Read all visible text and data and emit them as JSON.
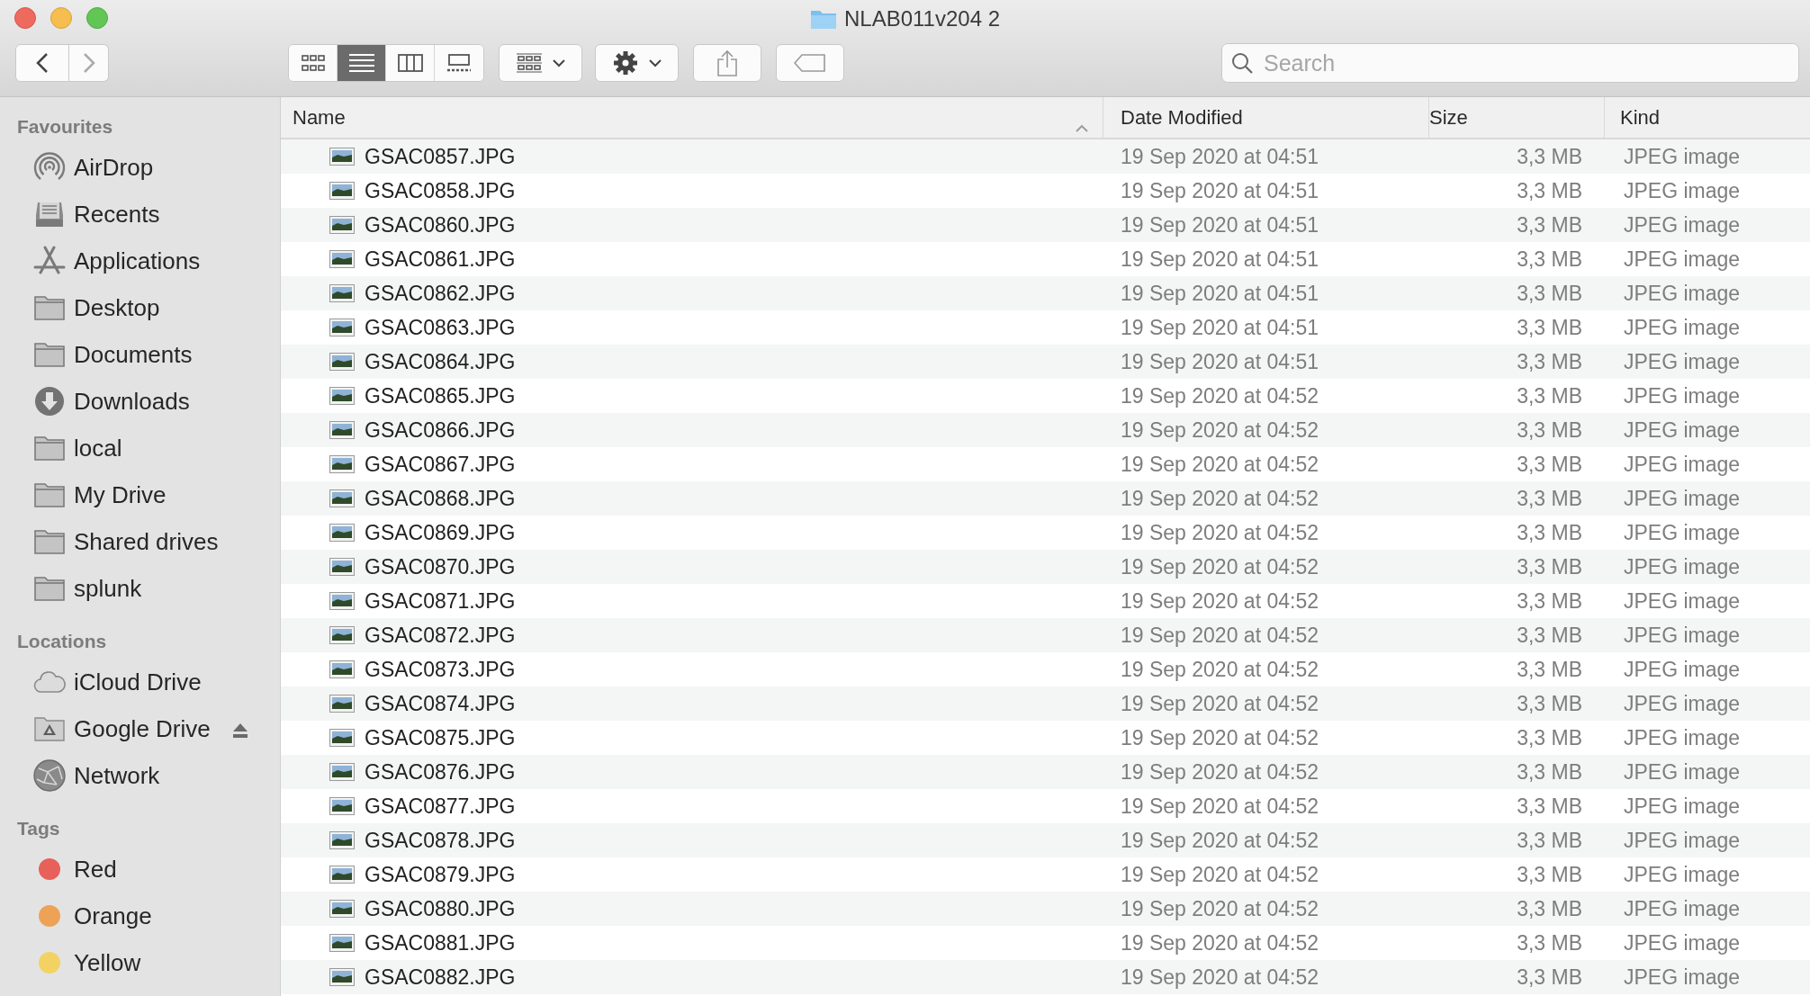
{
  "window": {
    "title": "NLAB011v204 2"
  },
  "toolbar": {
    "view_buttons": [
      {
        "kind": "icons",
        "selected": false
      },
      {
        "kind": "list",
        "selected": true
      },
      {
        "kind": "columns",
        "selected": false
      },
      {
        "kind": "gallery",
        "selected": false
      }
    ],
    "search": {
      "placeholder": "Search"
    }
  },
  "sidebar": {
    "sections": [
      {
        "heading": "Favourites",
        "items": [
          {
            "label": "AirDrop",
            "kind": "airdrop",
            "eject": false
          },
          {
            "label": "Recents",
            "kind": "recents",
            "eject": false
          },
          {
            "label": "Applications",
            "kind": "applications",
            "eject": false
          },
          {
            "label": "Desktop",
            "kind": "folder",
            "eject": false
          },
          {
            "label": "Documents",
            "kind": "folder",
            "eject": false
          },
          {
            "label": "Downloads",
            "kind": "downloads",
            "eject": false
          },
          {
            "label": "local",
            "kind": "folder",
            "eject": false
          },
          {
            "label": "My Drive",
            "kind": "folder",
            "eject": false
          },
          {
            "label": "Shared drives",
            "kind": "folder",
            "eject": false
          },
          {
            "label": "splunk",
            "kind": "folder",
            "eject": false
          }
        ]
      },
      {
        "heading": "Locations",
        "items": [
          {
            "label": "iCloud Drive",
            "kind": "cloud",
            "eject": false
          },
          {
            "label": "Google Drive",
            "kind": "drive",
            "eject": true
          },
          {
            "label": "Network",
            "kind": "network",
            "eject": false
          }
        ]
      },
      {
        "heading": "Tags",
        "items": [
          {
            "label": "Red",
            "kind": "tag",
            "color": "#e8605a",
            "eject": false
          },
          {
            "label": "Orange",
            "kind": "tag",
            "color": "#eea256",
            "eject": false
          },
          {
            "label": "Yellow",
            "kind": "tag",
            "color": "#f2d263",
            "eject": false
          }
        ]
      }
    ]
  },
  "table": {
    "columns": [
      {
        "label": "Name",
        "sorted": true
      },
      {
        "label": "Date Modified",
        "sorted": false
      },
      {
        "label": "Size",
        "sorted": false
      },
      {
        "label": "Kind",
        "sorted": false
      }
    ],
    "rows": [
      {
        "cells": [
          "GSAC0857.JPG",
          "19 Sep 2020 at 04:51",
          "3,3 MB",
          "JPEG image"
        ]
      },
      {
        "cells": [
          "GSAC0858.JPG",
          "19 Sep 2020 at 04:51",
          "3,3 MB",
          "JPEG image"
        ]
      },
      {
        "cells": [
          "GSAC0860.JPG",
          "19 Sep 2020 at 04:51",
          "3,3 MB",
          "JPEG image"
        ]
      },
      {
        "cells": [
          "GSAC0861.JPG",
          "19 Sep 2020 at 04:51",
          "3,3 MB",
          "JPEG image"
        ]
      },
      {
        "cells": [
          "GSAC0862.JPG",
          "19 Sep 2020 at 04:51",
          "3,3 MB",
          "JPEG image"
        ]
      },
      {
        "cells": [
          "GSAC0863.JPG",
          "19 Sep 2020 at 04:51",
          "3,3 MB",
          "JPEG image"
        ]
      },
      {
        "cells": [
          "GSAC0864.JPG",
          "19 Sep 2020 at 04:51",
          "3,3 MB",
          "JPEG image"
        ]
      },
      {
        "cells": [
          "GSAC0865.JPG",
          "19 Sep 2020 at 04:52",
          "3,3 MB",
          "JPEG image"
        ]
      },
      {
        "cells": [
          "GSAC0866.JPG",
          "19 Sep 2020 at 04:52",
          "3,3 MB",
          "JPEG image"
        ]
      },
      {
        "cells": [
          "GSAC0867.JPG",
          "19 Sep 2020 at 04:52",
          "3,3 MB",
          "JPEG image"
        ]
      },
      {
        "cells": [
          "GSAC0868.JPG",
          "19 Sep 2020 at 04:52",
          "3,3 MB",
          "JPEG image"
        ]
      },
      {
        "cells": [
          "GSAC0869.JPG",
          "19 Sep 2020 at 04:52",
          "3,3 MB",
          "JPEG image"
        ]
      },
      {
        "cells": [
          "GSAC0870.JPG",
          "19 Sep 2020 at 04:52",
          "3,3 MB",
          "JPEG image"
        ]
      },
      {
        "cells": [
          "GSAC0871.JPG",
          "19 Sep 2020 at 04:52",
          "3,3 MB",
          "JPEG image"
        ]
      },
      {
        "cells": [
          "GSAC0872.JPG",
          "19 Sep 2020 at 04:52",
          "3,3 MB",
          "JPEG image"
        ]
      },
      {
        "cells": [
          "GSAC0873.JPG",
          "19 Sep 2020 at 04:52",
          "3,3 MB",
          "JPEG image"
        ]
      },
      {
        "cells": [
          "GSAC0874.JPG",
          "19 Sep 2020 at 04:52",
          "3,3 MB",
          "JPEG image"
        ]
      },
      {
        "cells": [
          "GSAC0875.JPG",
          "19 Sep 2020 at 04:52",
          "3,3 MB",
          "JPEG image"
        ]
      },
      {
        "cells": [
          "GSAC0876.JPG",
          "19 Sep 2020 at 04:52",
          "3,3 MB",
          "JPEG image"
        ]
      },
      {
        "cells": [
          "GSAC0877.JPG",
          "19 Sep 2020 at 04:52",
          "3,3 MB",
          "JPEG image"
        ]
      },
      {
        "cells": [
          "GSAC0878.JPG",
          "19 Sep 2020 at 04:52",
          "3,3 MB",
          "JPEG image"
        ]
      },
      {
        "cells": [
          "GSAC0879.JPG",
          "19 Sep 2020 at 04:52",
          "3,3 MB",
          "JPEG image"
        ]
      },
      {
        "cells": [
          "GSAC0880.JPG",
          "19 Sep 2020 at 04:52",
          "3,3 MB",
          "JPEG image"
        ]
      },
      {
        "cells": [
          "GSAC0881.JPG",
          "19 Sep 2020 at 04:52",
          "3,3 MB",
          "JPEG image"
        ]
      },
      {
        "cells": [
          "GSAC0882.JPG",
          "19 Sep 2020 at 04:52",
          "3,3 MB",
          "JPEG image"
        ]
      }
    ]
  }
}
